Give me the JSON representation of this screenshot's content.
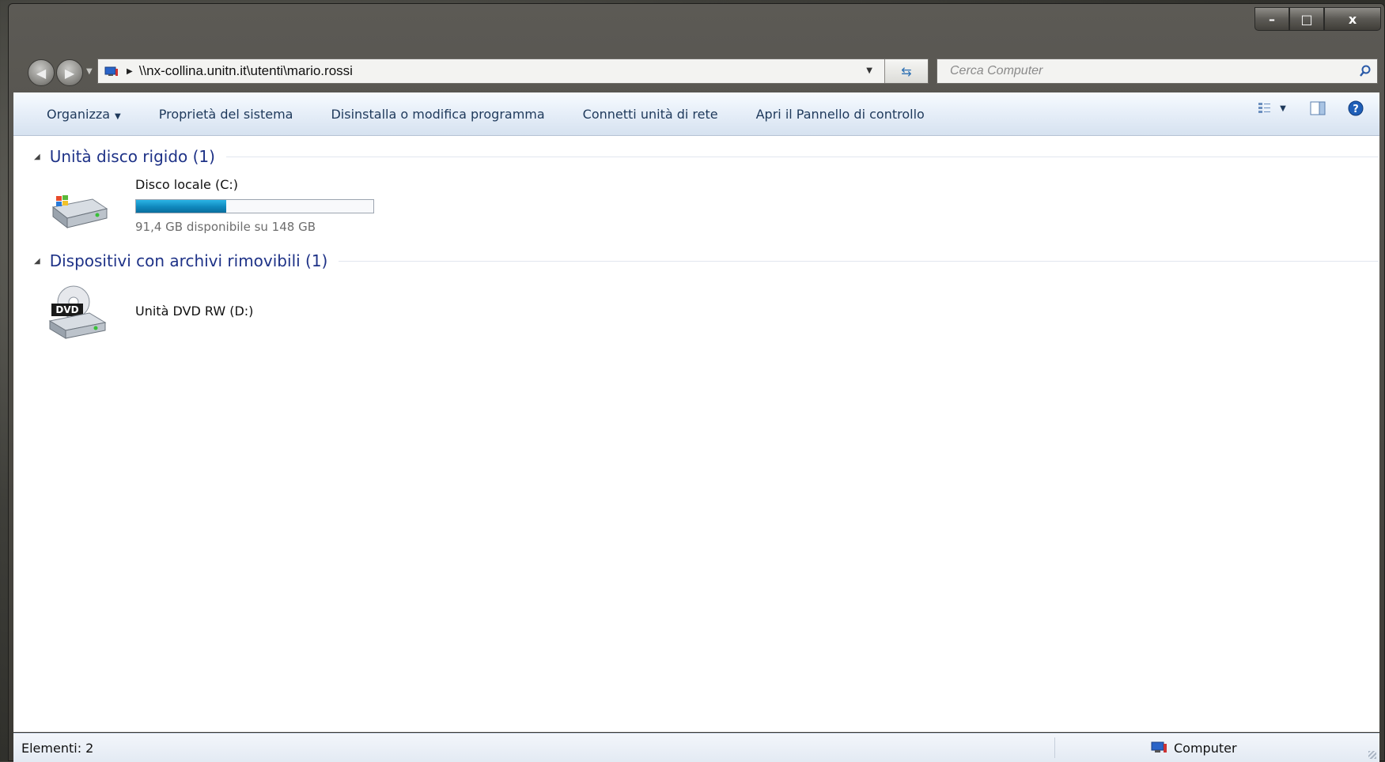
{
  "window": {
    "caption_buttons": {
      "minimize": "–",
      "maximize": "□",
      "close": "x"
    }
  },
  "nav": {
    "back_icon": "back-arrow-icon",
    "forward_icon": "forward-arrow-icon",
    "address_path": "\\\\nx-collina.unitn.it\\utenti\\mario.rossi",
    "search_placeholder": "Cerca Computer"
  },
  "toolbar": {
    "organize": "Organizza",
    "system_properties": "Proprietà del sistema",
    "uninstall": "Disinstalla o modifica programma",
    "map_drive": "Connetti unità di rete",
    "control_panel": "Apri il Pannello di controllo"
  },
  "groups": [
    {
      "title": "Unità disco rigido (1)",
      "items": [
        {
          "name": "Disco locale (C:)",
          "space": "91,4 GB disponibile su 148 GB",
          "used_fraction": 0.38
        }
      ]
    },
    {
      "title": "Dispositivi con archivi rimovibili (1)",
      "items": [
        {
          "name": "Unità DVD RW (D:)",
          "icon_label": "DVD"
        }
      ]
    }
  ],
  "status": {
    "items_count": "Elementi: 2",
    "location": "Computer"
  },
  "colors": {
    "accent_blue": "#1e3287",
    "bar_fill": "#1a9fd4"
  }
}
